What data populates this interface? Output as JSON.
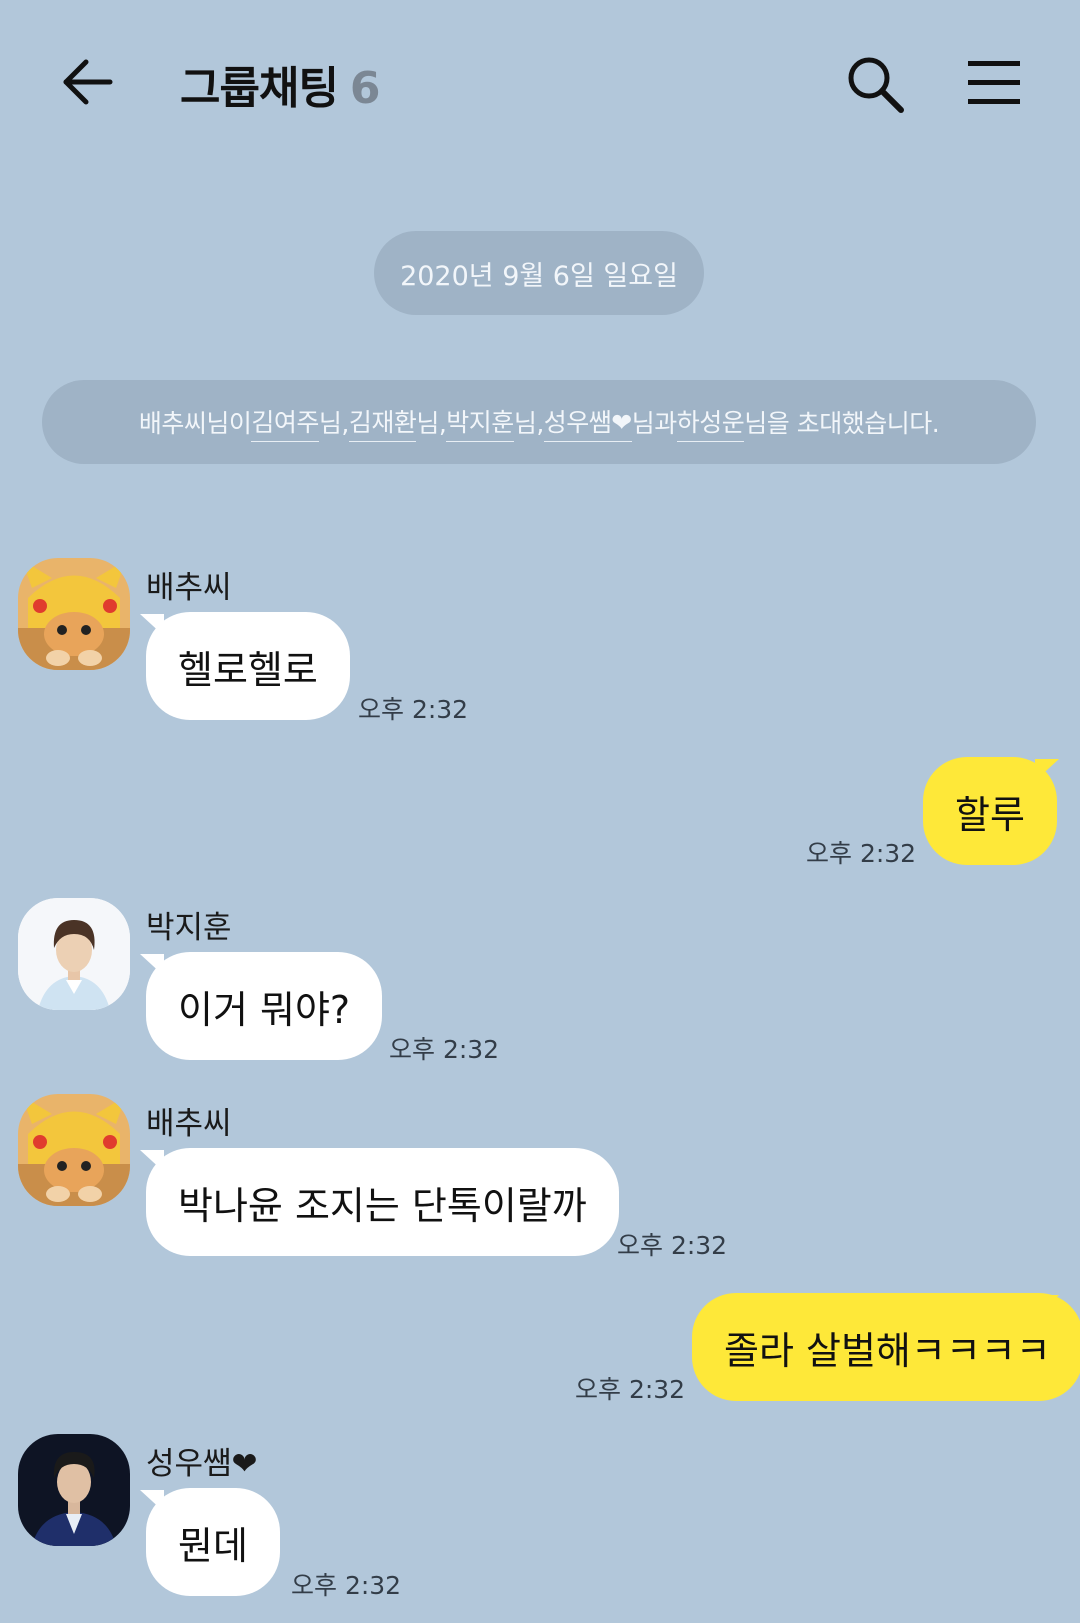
{
  "header": {
    "title": "그룹채팅",
    "member_count": "6"
  },
  "date_divider": "2020년 9월 6일 일요일",
  "system_message": {
    "prefix": "배추씨님이 ",
    "names": [
      "김여주",
      "김재환",
      "박지훈",
      "성우쌤❤",
      "하성운"
    ],
    "separator_1": "님, ",
    "separator_2": "님, ",
    "separator_3": "님, ",
    "separator_4": "님과 ",
    "suffix": "님을 초대했습니다."
  },
  "messages": [
    {
      "sender": "배추씨",
      "text": "헬로헬로",
      "time": "오후 2:32",
      "direction": "in",
      "avatar": "pikachu-cat-avatar"
    },
    {
      "sender": "",
      "text": "할루",
      "time": "오후 2:32",
      "direction": "out"
    },
    {
      "sender": "박지훈",
      "text": "이거 뭐야?",
      "time": "오후 2:32",
      "direction": "in",
      "avatar": "person-avatar"
    },
    {
      "sender": "배추씨",
      "text": "박나윤 조지는 단톡이랄까",
      "time": "오후 2:32",
      "direction": "in",
      "avatar": "pikachu-cat-avatar"
    },
    {
      "sender": "",
      "text": "졸라 살벌해ㅋㅋㅋㅋ",
      "time": "오후 2:32",
      "direction": "out"
    },
    {
      "sender": "성우쌤❤",
      "text": "뭔데",
      "time": "오후 2:32",
      "direction": "in",
      "avatar": "person-avatar"
    }
  ],
  "colors": {
    "background": "#b2c7da",
    "incoming_bubble": "#ffffff",
    "outgoing_bubble": "#fee839",
    "pill": "#9fb3c6",
    "heart": "#e0282e"
  }
}
